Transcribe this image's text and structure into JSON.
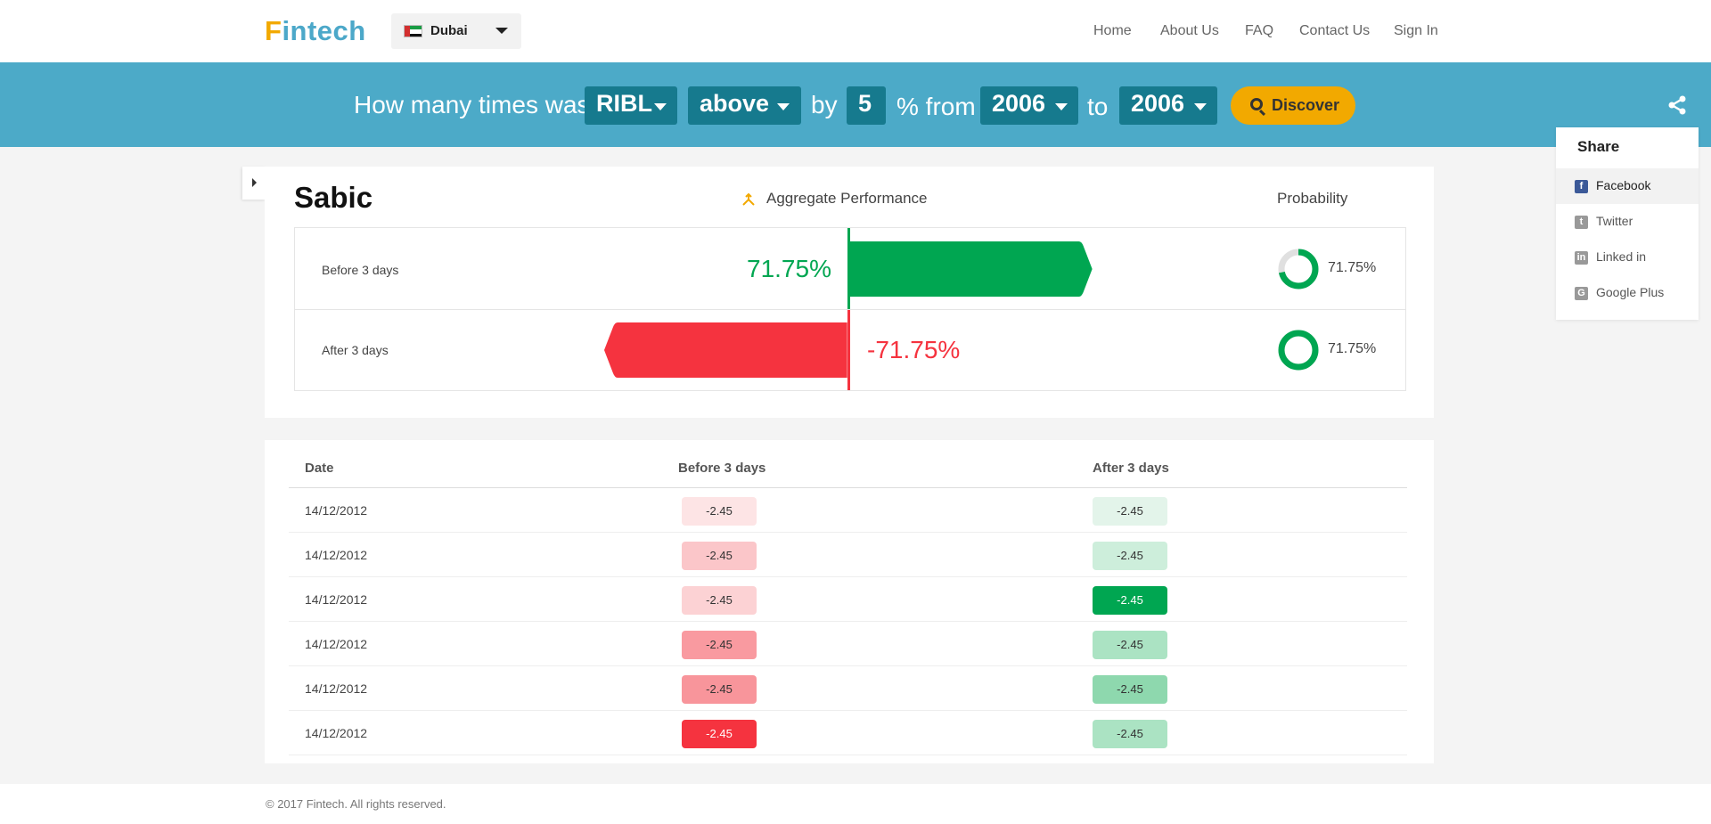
{
  "brand": {
    "logo_first": "F",
    "logo_rest": "intech"
  },
  "country": {
    "name": "Dubai",
    "flag": "uae-flag-icon"
  },
  "nav": {
    "home": "Home",
    "about": "About Us",
    "faq": "FAQ",
    "contact": "Contact Us",
    "signin": "Sign In"
  },
  "query": {
    "prefix": "How many times was",
    "symbol": "RIBL",
    "direction": "above",
    "by_label": "by",
    "amount": "5",
    "pct_from_label": "% from",
    "from_year": "2006",
    "to_label": "to",
    "to_year": "2006",
    "discover_label": "Discover"
  },
  "share": {
    "title": "Share",
    "items": [
      {
        "label": "Facebook",
        "icon": "facebook-icon",
        "color": "#3b5998"
      },
      {
        "label": "Twitter",
        "icon": "twitter-icon",
        "color": "#999999"
      },
      {
        "label": "Linked in",
        "icon": "linkedin-icon",
        "color": "#999999"
      },
      {
        "label": "Google Plus",
        "icon": "google-plus-icon",
        "color": "#999999"
      }
    ]
  },
  "summary": {
    "stock": "Sabic",
    "aggregate_title": "Aggregate Performance",
    "probability_title": "Probability",
    "rows": [
      {
        "label": "Before 3 days",
        "performance": "71.75%",
        "performance_value": 71.75,
        "probability": "71.75%",
        "probability_value": 0.7175
      },
      {
        "label": "After 3 days",
        "performance": "-71.75%",
        "performance_value": -71.75,
        "probability": "71.75%",
        "probability_value": 1.0
      }
    ]
  },
  "table": {
    "headers": {
      "date": "Date",
      "before": "Before 3 days",
      "after": "After 3 days"
    },
    "rows": [
      {
        "date": "14/12/2012",
        "before": "-2.45",
        "after": "-2.45",
        "before_color": "#fde4e5",
        "after_color": "#e3f4ea"
      },
      {
        "date": "14/12/2012",
        "before": "-2.45",
        "after": "-2.45",
        "before_color": "#fbc6c9",
        "after_color": "#cdeedb"
      },
      {
        "date": "14/12/2012",
        "before": "-2.45",
        "after": "-2.45",
        "before_color": "#fcd2d4",
        "after_color": "#00a651"
      },
      {
        "date": "14/12/2012",
        "before": "-2.45",
        "after": "-2.45",
        "before_color": "#f99aa0",
        "after_color": "#abe3c3"
      },
      {
        "date": "14/12/2012",
        "before": "-2.45",
        "after": "-2.45",
        "before_color": "#f8959b",
        "after_color": "#8ed8ae"
      },
      {
        "date": "14/12/2012",
        "before": "-2.45",
        "after": "-2.45",
        "before_color": "#f5333f",
        "after_color": "#abe3c3"
      }
    ]
  },
  "footer": {
    "copyright": "© 2017 Fintech. All rights reserved."
  },
  "colors": {
    "band": "#4caac8",
    "select": "#167a8e",
    "accent": "#f2a900",
    "positive": "#00a651",
    "negative": "#f5333f"
  }
}
